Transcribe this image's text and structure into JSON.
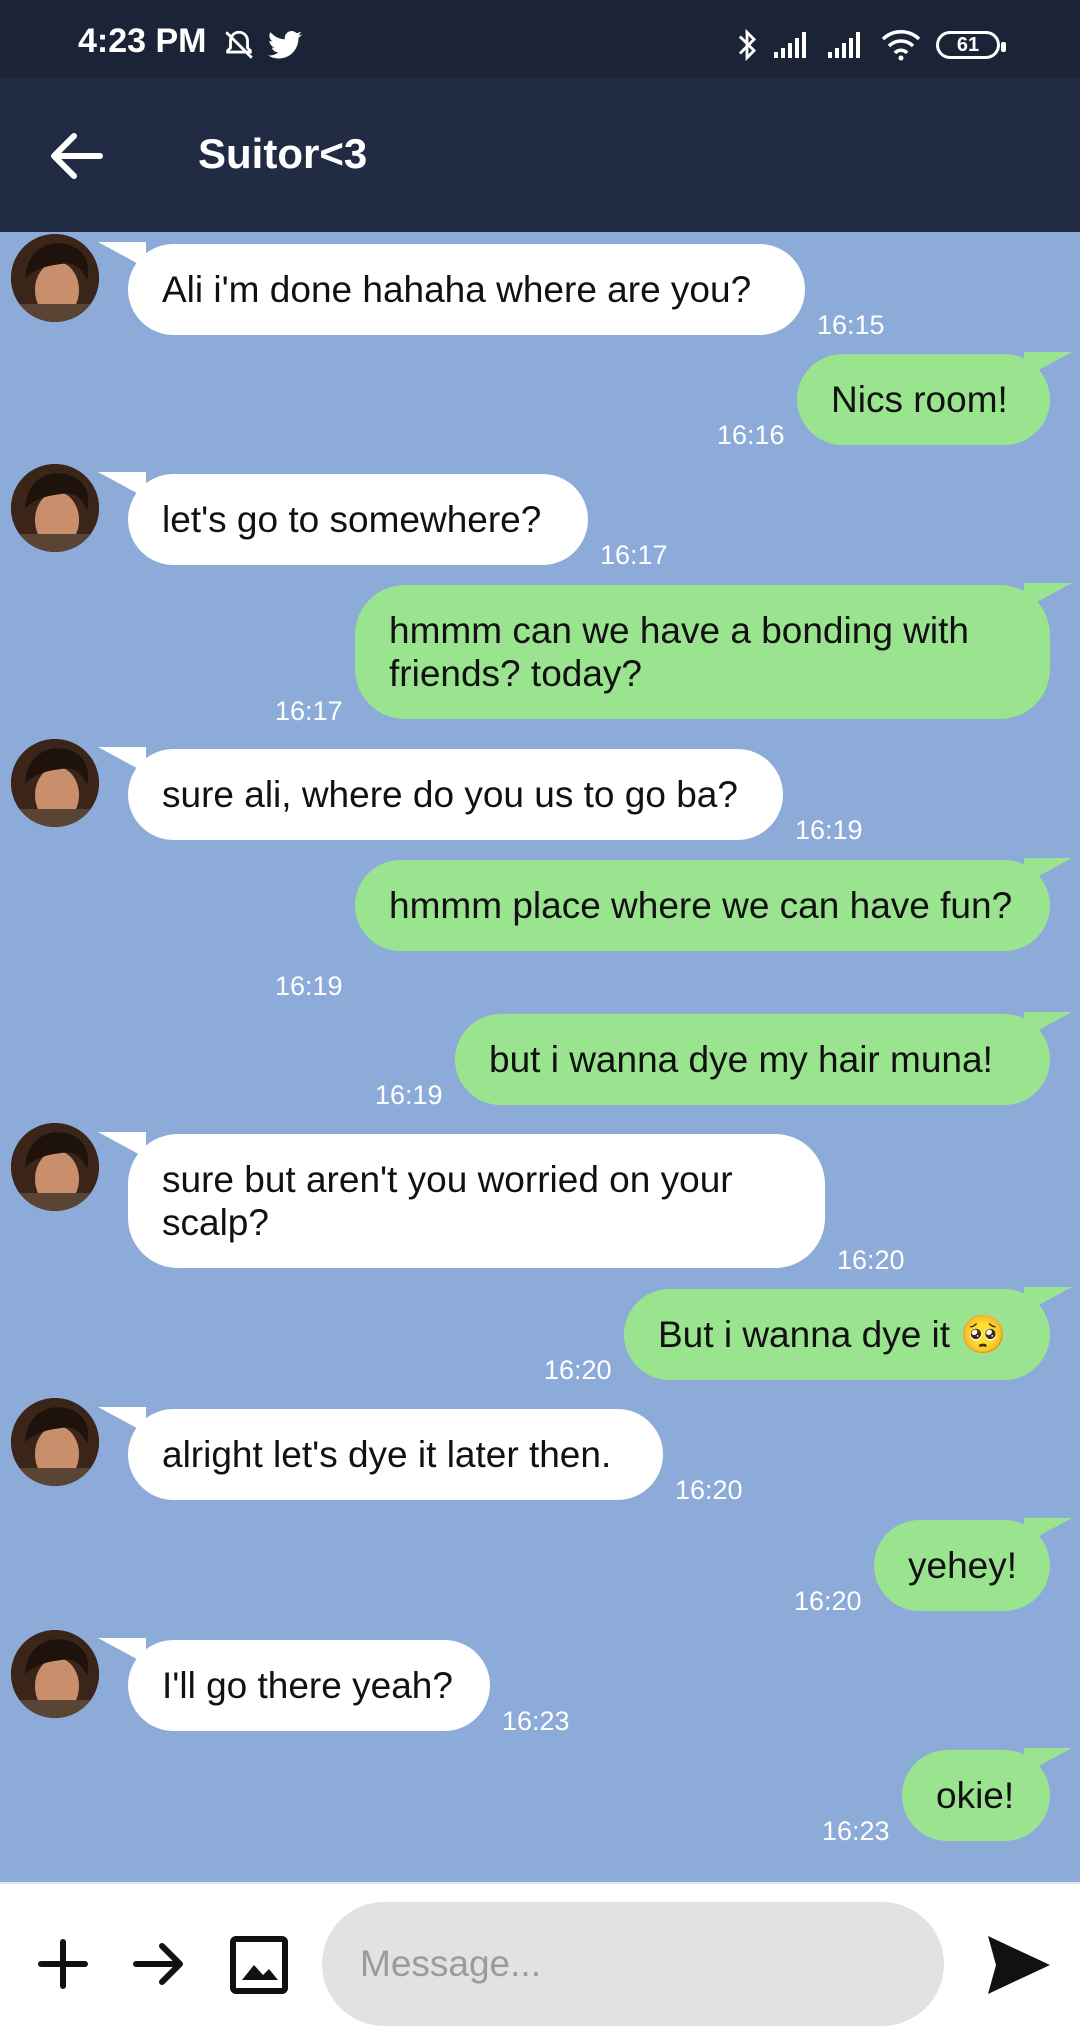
{
  "status_bar": {
    "time": "4:23 PM",
    "battery": "61"
  },
  "header": {
    "title": "Suitor<3"
  },
  "messages": [
    {
      "direction": "in",
      "text": "Ali i'm done hahaha where are you?",
      "time": "16:15"
    },
    {
      "direction": "out",
      "text": "Nics room!",
      "time": "16:16"
    },
    {
      "direction": "in",
      "text": "let's go to somewhere?",
      "time": "16:17"
    },
    {
      "direction": "out",
      "text": "hmmm can we have a bonding with friends? today?",
      "time": "16:17"
    },
    {
      "direction": "in",
      "text": "sure ali, where do you us to go ba?",
      "time": "16:19"
    },
    {
      "direction": "out",
      "text": "hmmm place where we can have fun?",
      "time": "16:19"
    },
    {
      "direction": "out",
      "text": "but i wanna dye my hair muna!",
      "time": "16:19"
    },
    {
      "direction": "in",
      "text": "sure but aren't you worried on your scalp?",
      "time": "16:20"
    },
    {
      "direction": "out",
      "text": "But i wanna dye it 🥺",
      "time": "16:20"
    },
    {
      "direction": "in",
      "text": "alright let's dye it later then.",
      "time": "16:20"
    },
    {
      "direction": "out",
      "text": "yehey!",
      "time": "16:20"
    },
    {
      "direction": "in",
      "text": "I'll go there yeah?",
      "time": "16:23"
    },
    {
      "direction": "out",
      "text": "okie!",
      "time": "16:23"
    }
  ],
  "input": {
    "placeholder": "Message..."
  },
  "colors": {
    "status_bar": "#1B2437",
    "app_bar": "#212C44",
    "chat_background": "#8CABD8",
    "incoming_bubble": "#FFFFFF",
    "outgoing_bubble": "#9AE48F"
  },
  "icons": [
    "back-arrow-icon",
    "mute-icon",
    "twitter-icon",
    "bluetooth-icon",
    "signal-icon",
    "wifi-icon",
    "plus-icon",
    "forward-arrow-icon",
    "image-icon",
    "send-icon"
  ]
}
